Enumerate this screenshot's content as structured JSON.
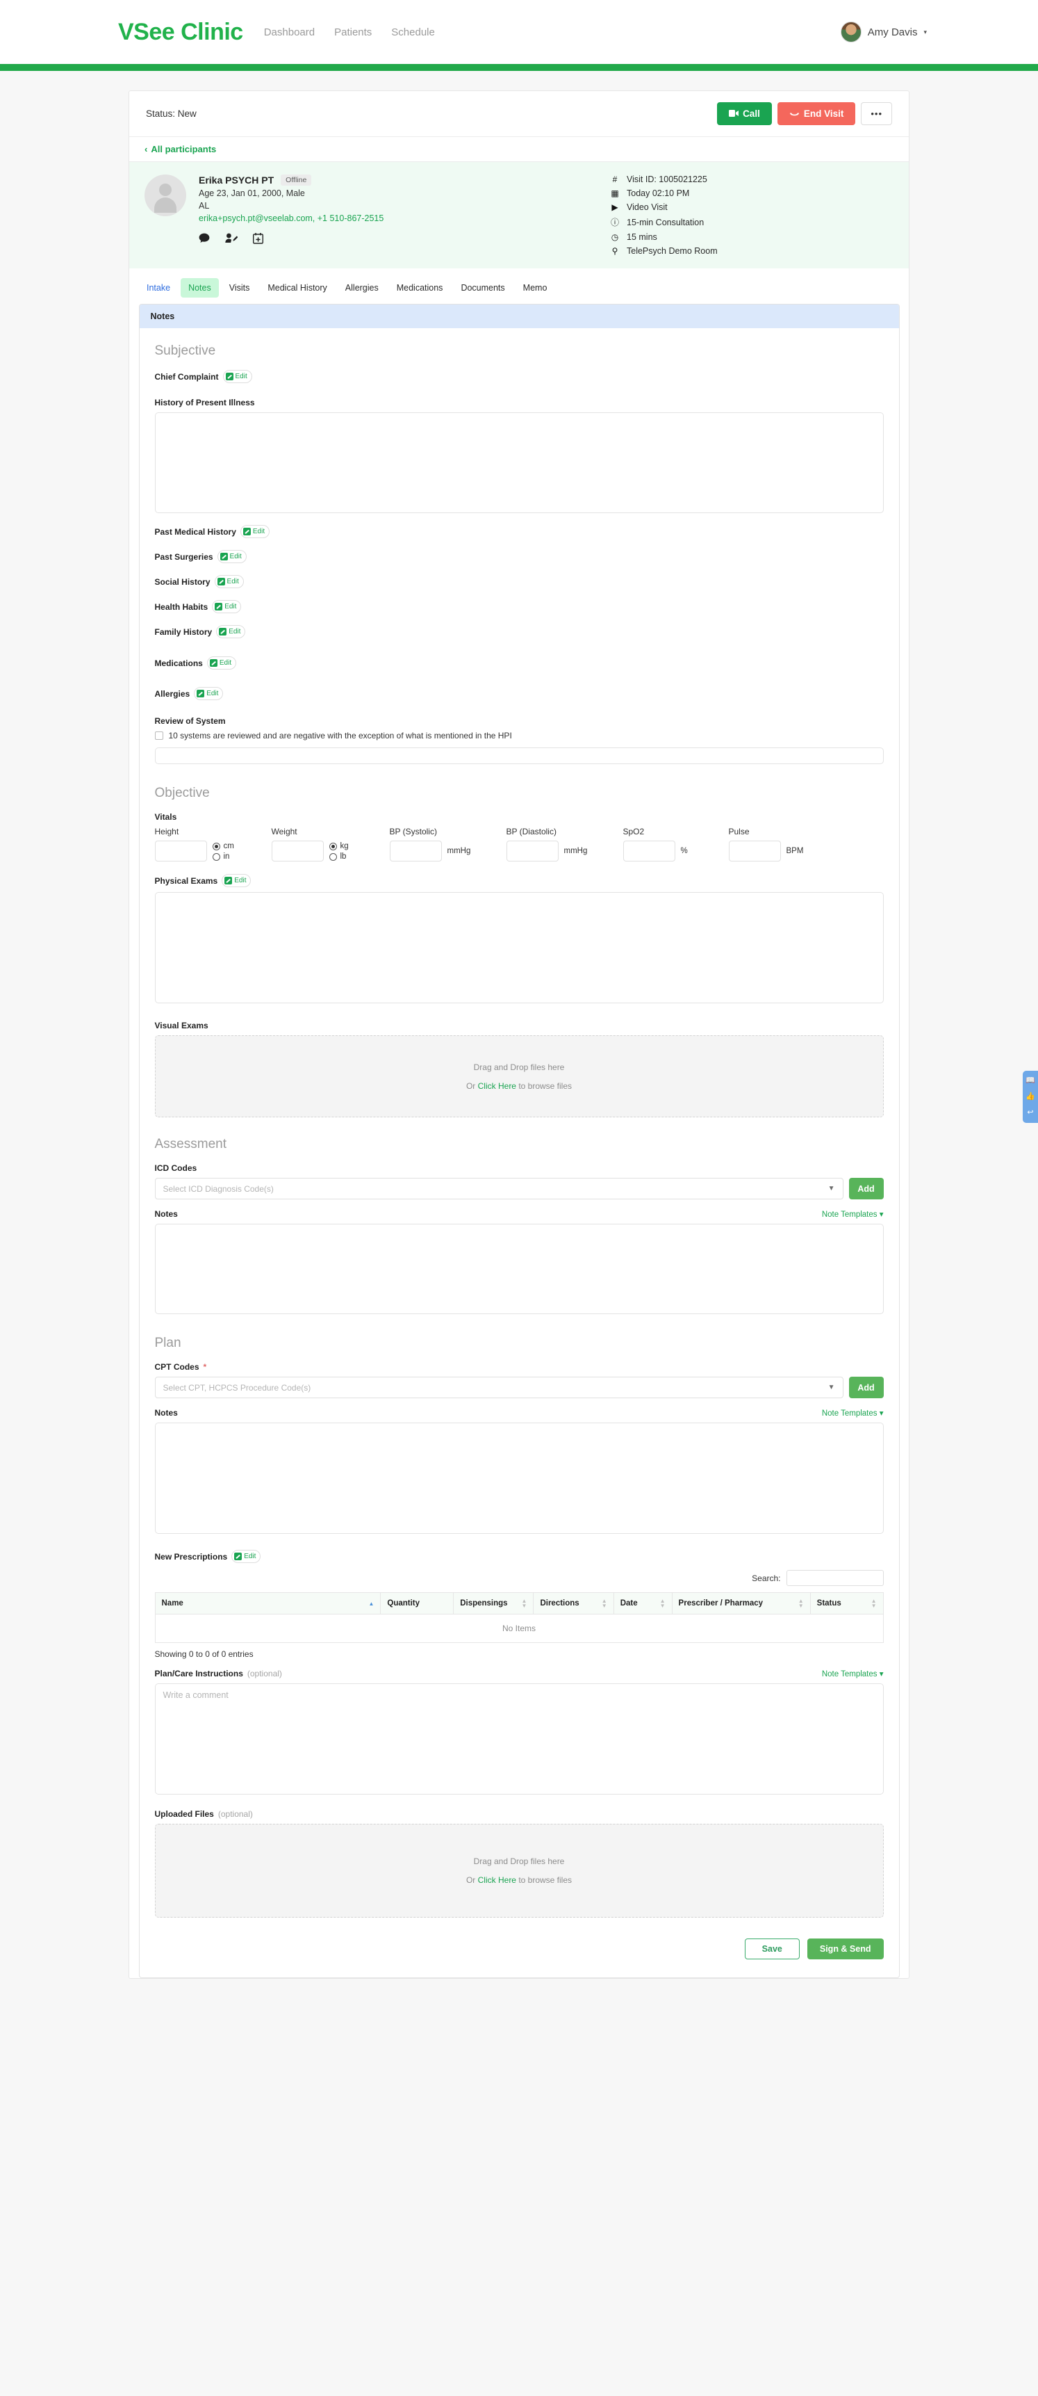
{
  "nav": {
    "brand": "VSee Clinic",
    "links": [
      "Dashboard",
      "Patients",
      "Schedule"
    ],
    "user": "Amy Davis",
    "caret": "▾"
  },
  "status": {
    "label": "Status: New",
    "call_label": "Call",
    "end_visit_label": "End Visit",
    "more_label": "•••"
  },
  "participants": {
    "back_label": "All participants",
    "chevron": "‹"
  },
  "patient": {
    "name": "Erika PSYCH PT",
    "presence": "Offline",
    "demographics": "Age 23, Jan 01, 2000, Male",
    "state": "AL",
    "contact": "erika+psych.pt@vseelab.com, +1 510-867-2515",
    "icons": [
      "chat-icon",
      "edit-participant-icon",
      "calendar-add-icon"
    ]
  },
  "visit": [
    {
      "icon": "#",
      "text": "Visit ID: 1005021225"
    },
    {
      "icon": "▦",
      "text": "Today 02:10 PM"
    },
    {
      "icon": "▶",
      "text": "Video Visit"
    },
    {
      "icon": "ⓘ",
      "text": "15-min Consultation"
    },
    {
      "icon": "◷",
      "text": "15 mins"
    },
    {
      "icon": "⚲",
      "text": "TelePsych Demo Room"
    }
  ],
  "tabs": [
    {
      "label": "Intake",
      "state": "link"
    },
    {
      "label": "Notes",
      "state": "active"
    },
    {
      "label": "Visits",
      "state": "normal"
    },
    {
      "label": "Medical History",
      "state": "normal"
    },
    {
      "label": "Allergies",
      "state": "normal"
    },
    {
      "label": "Medications",
      "state": "normal"
    },
    {
      "label": "Documents",
      "state": "normal"
    },
    {
      "label": "Memo",
      "state": "normal"
    }
  ],
  "panel": {
    "header": "Notes"
  },
  "edit_label": "Edit",
  "subjective": {
    "title": "Subjective",
    "chief_complaint": "Chief Complaint",
    "hpi_label": "History of Present Illness",
    "hpi_value": "",
    "items": [
      "Past Medical History",
      "Past Surgeries",
      "Social History",
      "Health Habits",
      "Family History",
      "Medications",
      "Allergies"
    ],
    "ros_label": "Review of System",
    "ros_checkbox": "10 systems are reviewed and are negative with the exception of what is mentioned in the HPI",
    "ros_value": ""
  },
  "objective": {
    "title": "Objective",
    "vitals_label": "Vitals",
    "height": {
      "label": "Height",
      "value": "",
      "units": [
        "cm",
        "in"
      ],
      "selected": "cm"
    },
    "weight": {
      "label": "Weight",
      "value": "",
      "units": [
        "kg",
        "lb"
      ],
      "selected": "kg"
    },
    "bp_systolic": {
      "label": "BP (Systolic)",
      "value": "",
      "unit": "mmHg"
    },
    "bp_diastolic": {
      "label": "BP (Diastolic)",
      "value": "",
      "unit": "mmHg"
    },
    "spo2": {
      "label": "SpO2",
      "value": "",
      "unit": "%"
    },
    "pulse": {
      "label": "Pulse",
      "value": "",
      "unit": "BPM"
    },
    "physical_exams_label": "Physical Exams",
    "physical_exams_value": "",
    "visual_exams_label": "Visual Exams"
  },
  "dropzone": {
    "drag_text": "Drag and Drop files here",
    "or_text": "Or ",
    "link_text": "Click Here",
    "tail_text": " to browse files"
  },
  "assessment": {
    "title": "Assessment",
    "icd_label": "ICD Codes",
    "icd_placeholder": "Select ICD Diagnosis Code(s)",
    "add_label": "Add",
    "notes_label": "Notes",
    "note_templates": "Note Templates ▾",
    "notes_value": ""
  },
  "plan": {
    "title": "Plan",
    "cpt_label": "CPT Codes",
    "cpt_required": "*",
    "cpt_placeholder": "Select CPT, HCPCS Procedure Code(s)",
    "add_label": "Add",
    "notes_label": "Notes",
    "note_templates": "Note Templates ▾",
    "notes_value": ""
  },
  "prescriptions": {
    "label": "New Prescriptions",
    "search_label": "Search:",
    "search_value": "",
    "columns": [
      "Name",
      "Quantity",
      "Dispensings",
      "Directions",
      "Date",
      "Prescriber / Pharmacy",
      "Status"
    ],
    "empty_text": "No Items",
    "entries_text": "Showing 0 to 0 of 0 entries"
  },
  "care_instructions": {
    "label": "Plan/Care Instructions",
    "optional": "(optional)",
    "note_templates": "Note Templates ▾",
    "placeholder": "Write a comment",
    "value": ""
  },
  "uploaded_files": {
    "label": "Uploaded Files",
    "optional": "(optional)"
  },
  "footer": {
    "save_label": "Save",
    "sign_label": "Sign & Send"
  },
  "float_widget": {
    "icons": [
      "book-icon",
      "thumbs-feedback-icon",
      "reply-icon"
    ],
    "glyphs": [
      "📖",
      "👍",
      "↩"
    ]
  },
  "colors": {
    "brand_green": "#21b24b",
    "accent_green": "#1aa451",
    "danger_red": "#f4675c",
    "tab_active_bg": "#c9f7d9",
    "panel_header_bg": "#dbe8fb",
    "patient_strip_bg": "#effaf3"
  }
}
